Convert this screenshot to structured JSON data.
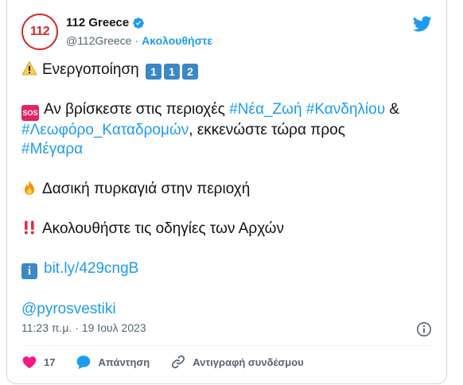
{
  "author": {
    "name": "112 Greece",
    "handle": "@112Greece",
    "follow_label": "Ακολουθήστε",
    "avatar_text": "112"
  },
  "tweet": {
    "line1": {
      "text": "Ενεργοποίηση",
      "keycaps": [
        "1",
        "1",
        "2"
      ]
    },
    "sos_badge": "SOS",
    "line2_prefix": "Αν βρίσκεστε στις περιοχές ",
    "tag1": "#Νέα_Ζωή",
    "tag2": "#Κανδηλίου",
    "amp": " &",
    "tag3": "#Λεωφόρο_Καταδρομών",
    "line3_rest": ", εκκενώστε τώρα προς",
    "tag4": "#Μέγαρα",
    "line4": "Δασική πυρκαγιά στην περιοχή",
    "line5": "Ακολουθήστε τις οδηγίες των Αρχών",
    "info_badge": "i",
    "link": "bit.ly/429cngB",
    "mention": "@pyrosvestiki"
  },
  "meta": {
    "time": "11:23 π.μ.",
    "separator": "·",
    "date": "19 Ιουλ 2023"
  },
  "actions": {
    "likes": "17",
    "reply_label": "Απάντηση",
    "copy_label": "Αντιγραφή συνδέσμου"
  },
  "colors": {
    "accent": "#1d9bf0",
    "like": "#f91880",
    "brand_red": "#d52b2b"
  }
}
